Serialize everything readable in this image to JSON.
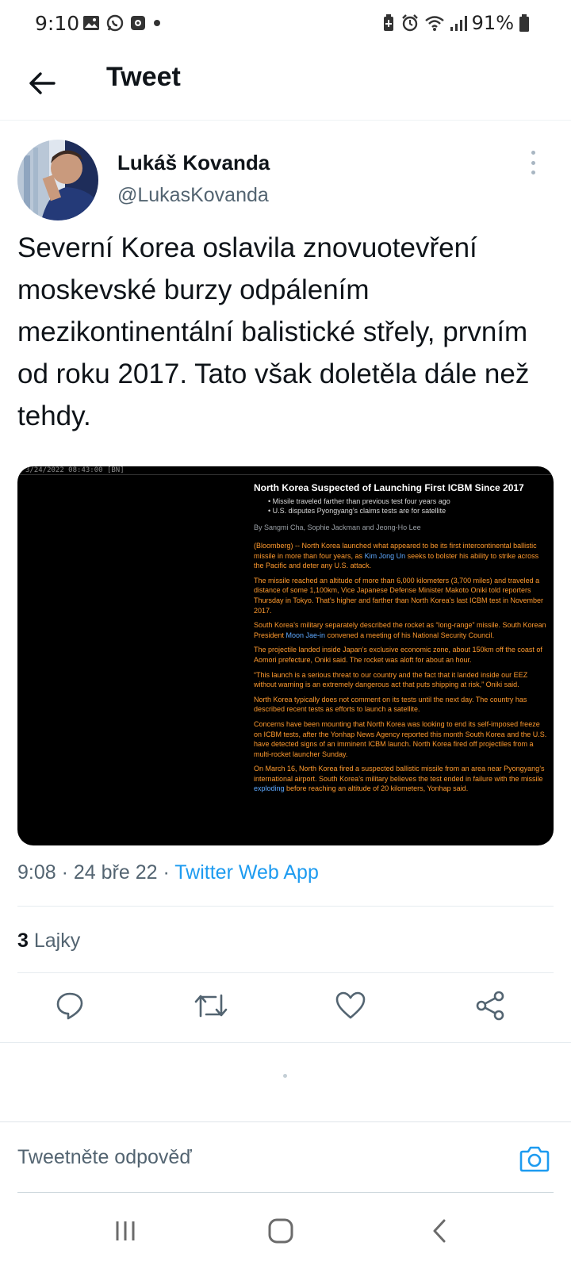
{
  "status_bar": {
    "time": "9:10",
    "battery": "91%",
    "left_icons": [
      "gallery-icon",
      "whatsapp-icon",
      "media-icon",
      "dot-icon"
    ],
    "right_icons": [
      "battery-saver-icon",
      "alarm-icon",
      "wifi-icon",
      "signal-icon",
      "battery-icon"
    ]
  },
  "header": {
    "title": "Tweet"
  },
  "tweet": {
    "author_name": "Lukáš Kovanda",
    "author_handle": "@LukasKovanda",
    "text": "Severní Korea oslavila znovuotevření moskevské burzy odpálením mezikontinentální balistické střely, prvním od roku 2017. Tato však doletěla dále než tehdy.",
    "timestamp": "9:08 · 24 bře 22 · ",
    "source": "Twitter Web App",
    "likes_count": "3",
    "likes_label": "Lajky"
  },
  "media": {
    "stamp": "3/24/2022 08:43:00 [BN]",
    "headline": "North Korea Suspected of Launching First ICBM Since 2017",
    "bullets": [
      "Missile traveled farther than previous test four years ago",
      "U.S. disputes Pyongyang’s claims tests are for satellite"
    ],
    "byline": "By Sangmi Cha, Sophie Jackman and Jeong-Ho Lee",
    "p1_a": "(Bloomberg) -- North Korea launched what appeared to be its first intercontinental ballistic missile in more than four years, as ",
    "p1_link": "Kim Jong Un",
    "p1_b": " seeks to bolster his ability to strike across the Pacific and deter any U.S. attack.",
    "p2": "The missile reached an altitude of more than 6,000 kilometers (3,700 miles) and traveled a distance of some 1,100km, Vice Japanese Defense Minister Makoto Oniki told reporters Thursday in Tokyo. That’s higher and farther than North Korea’s last ICBM test in November 2017.",
    "p3_a": "South Korea’s military separately described the rocket as “long-range” missile. South Korean President ",
    "p3_link": "Moon Jae-in",
    "p3_b": " convened a meeting of his National Security Council.",
    "p4": "The projectile landed inside Japan’s exclusive economic zone, about 150km off the coast of Aomori prefecture, Oniki said. The rocket was aloft for about an hour.",
    "p5": "“This launch is a serious threat to our country and the fact that it landed inside our EEZ without warning is an extremely dangerous act that puts shipping at risk,” Oniki said.",
    "p6": "North Korea typically does not comment on its tests until the next day. The country has described recent tests as efforts to launch a satellite.",
    "p7": "Concerns have been mounting that North Korea was looking to end its self-imposed freeze on ICBM tests, after the Yonhap News Agency reported this month South Korea and the U.S. have detected signs of an imminent ICBM launch. North Korea fired off projectiles from a multi-rocket launcher Sunday.",
    "p8_a": "On March 16, North Korea fired a suspected ballistic missile from an area near Pyongyang’s international airport. South Korea’s military believes the test ended in failure with the missile ",
    "p8_link": "exploding",
    "p8_b": " before reaching an altitude of 20 kilometers, Yonhap said."
  },
  "actions": [
    "reply-icon",
    "retweet-icon",
    "like-icon",
    "share-icon"
  ],
  "reply": {
    "placeholder": "Tweetněte odpověď"
  },
  "colors": {
    "accent": "#1d9bf0",
    "text_primary": "#0f1419",
    "text_secondary": "#536471",
    "article_text": "#ff9a2e",
    "article_link": "#5ea9ff"
  }
}
